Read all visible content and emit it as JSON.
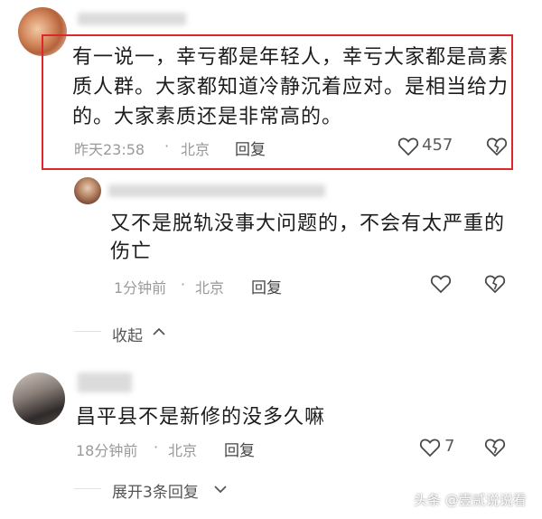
{
  "comments": [
    {
      "text_line1": "有一说一，幸亏都是年轻人，幸亏大家都是高素",
      "text_line2": "质人群。大家都知道冷静沉着应对。是相当给力",
      "text_line3": "的。大家素质还是非常高的。",
      "time": "昨天23:58",
      "location": "北京",
      "reply_label": "回复",
      "likes": "457",
      "highlight_color": "#e0262d"
    },
    {
      "text_line1": "又不是脱轨没事大问题的，不会有太严重的",
      "text_line2": "伤亡",
      "time": "1分钟前",
      "location": "北京",
      "reply_label": "回复",
      "collapse_label": "收起"
    },
    {
      "text_line1": "昌平县不是新修的没多久嘛",
      "time": "18分钟前",
      "location": "北京",
      "reply_label": "回复",
      "likes": "7",
      "expand_label": "展开3条回复"
    }
  ],
  "separator": "·",
  "watermark": "头条 @壹贰说说看",
  "icons": [
    "heart-icon",
    "dislike-icon",
    "chevron-up-icon",
    "chevron-down-icon"
  ]
}
